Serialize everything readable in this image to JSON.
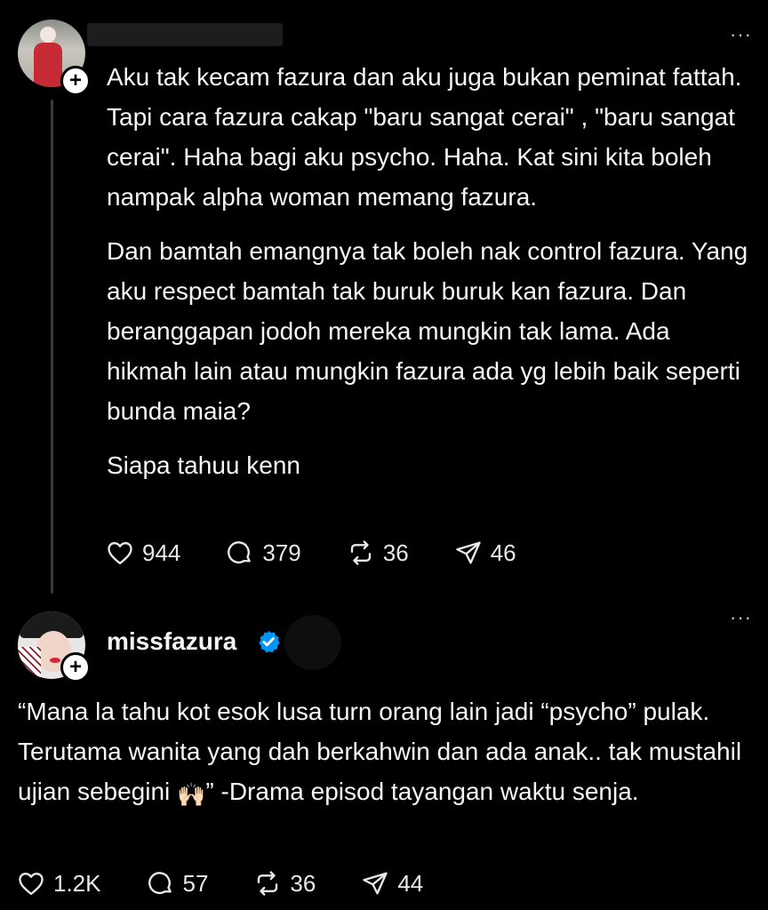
{
  "post1": {
    "paragraphs": [
      "Aku tak kecam fazura dan aku juga bukan peminat fattah. Tapi cara fazura cakap \"baru sangat cerai\" , \"baru sangat cerai\". Haha bagi aku psycho. Haha. Kat sini kita boleh nampak alpha woman memang fazura.",
      "Dan bamtah emangnya tak boleh nak control fazura. Yang aku respect bamtah tak buruk buruk kan fazura. Dan beranggapan jodoh mereka mungkin tak lama. Ada hikmah lain atau mungkin fazura ada yg lebih baik seperti bunda maia?",
      "Siapa tahuu kenn"
    ],
    "actions": {
      "likes": "944",
      "replies": "379",
      "reposts": "36",
      "shares": "46"
    },
    "follow_symbol": "+",
    "more_symbol": "···"
  },
  "post2": {
    "username": "missfazura",
    "verified": true,
    "text_before_emoji": "“Mana la tahu kot esok lusa turn orang lain jadi “psycho” pulak. Terutama wanita yang dah berkahwin dan ada anak.. tak mustahil ujian sebegini ",
    "emoji": "🙌🏻",
    "text_after_emoji": "” -Drama episod tayangan waktu senja.",
    "actions": {
      "likes": "1.2K",
      "replies": "57",
      "reposts": "36",
      "shares": "44"
    },
    "follow_symbol": "+",
    "more_symbol": "···"
  },
  "colors": {
    "background": "#000000",
    "text": "#f3f5f7",
    "verified": "#0095f6",
    "thread_line": "#3a3a3a"
  }
}
